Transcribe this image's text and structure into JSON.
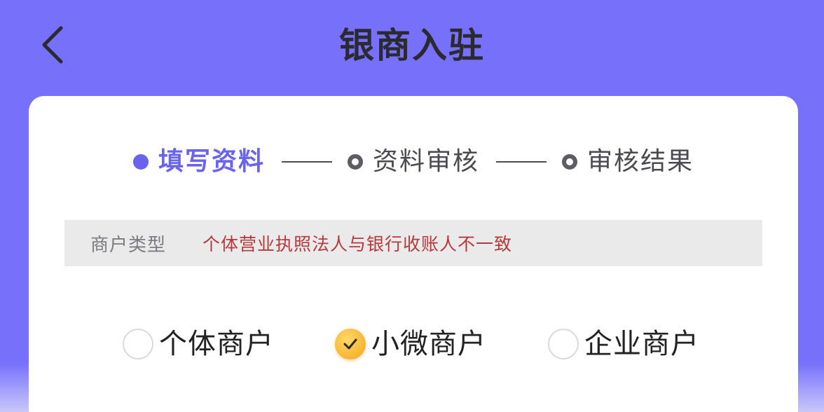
{
  "header": {
    "title": "银商入驻",
    "back_icon": "chevron-left-icon"
  },
  "steps": [
    {
      "label": "填写资料",
      "state": "active"
    },
    {
      "label": "资料审核",
      "state": "pending"
    },
    {
      "label": "审核结果",
      "state": "pending"
    }
  ],
  "merchant_type": {
    "label": "商户类型",
    "warning": "个体营业执照法人与银行收账人不一致"
  },
  "options": [
    {
      "label": "个体商户",
      "checked": false
    },
    {
      "label": "小微商户",
      "checked": true
    },
    {
      "label": "企业商户",
      "checked": false
    }
  ],
  "colors": {
    "header_bg": "#7670fb",
    "accent": "#6a63ee",
    "warning": "#b5393c",
    "check": "#f7b52f"
  }
}
